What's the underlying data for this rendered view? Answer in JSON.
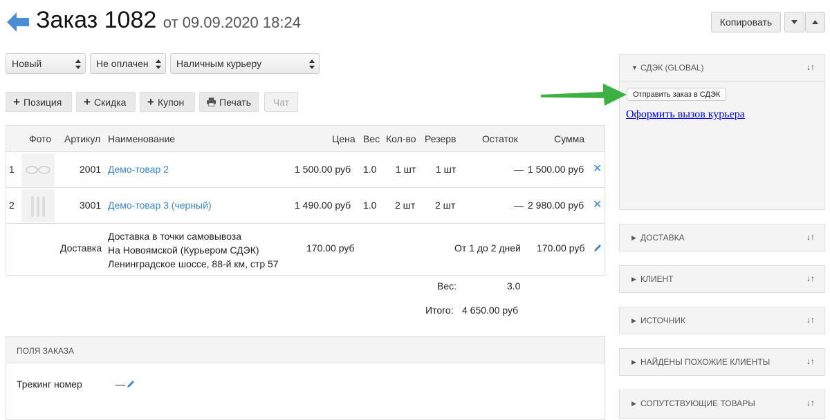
{
  "header": {
    "title": "Заказ 1082",
    "subtitle": "от 09.09.2020 18:24",
    "copy_label": "Копировать"
  },
  "selects": {
    "status": "Новый",
    "payment": "Не оплачен",
    "delivery": "Наличным курьеру"
  },
  "toolbar": {
    "position": "Позиция",
    "discount": "Скидка",
    "coupon": "Купон",
    "print": "Печать",
    "chat": "Чат"
  },
  "table": {
    "columns": [
      "Фото",
      "Артикул",
      "Наименование",
      "Цена",
      "Вес",
      "Кол-во",
      "Резерв",
      "Остаток",
      "Сумма"
    ],
    "rows": [
      {
        "num": "1",
        "sku": "2001",
        "name": "Демо-товар 2",
        "price": "1 500.00 руб",
        "weight": "1.0",
        "qty": "1 шт",
        "reserve": "1 шт",
        "stock": "—",
        "sum": "1 500.00 руб"
      },
      {
        "num": "2",
        "sku": "3001",
        "name": "Демо-товар 3 (черный)",
        "price": "1 490.00 руб",
        "weight": "1.0",
        "qty": "2 шт",
        "reserve": "2 шт",
        "stock": "—",
        "sum": "2 980.00 руб"
      }
    ],
    "shipping": {
      "label": "Доставка",
      "line1": "Доставка в точки самовывоза",
      "line2": "На Новоямской (Курьером СДЭК)",
      "line3": "Ленинградское шоссе, 88-й км, стр 57",
      "price": "170.00 руб",
      "term": "От 1 до 2 дней",
      "sum": "170.00 руб"
    }
  },
  "totals": {
    "weight_label": "Вес:",
    "weight": "3.0",
    "total_label": "Итого:",
    "total": "4 650.00 руб"
  },
  "order_fields": {
    "header": "ПОЛЯ ЗАКАЗА",
    "tracking_label": "Трекинг номер",
    "tracking_value": "—"
  },
  "panels": {
    "cdek_title": "СДЭК (GLOBAL)",
    "send_button": "Отправить заказ в СДЭК",
    "courier_link": "Оформить вызов курьера",
    "collapsed": [
      "ДОСТАВКА",
      "КЛИЕНТ",
      "ИСТОЧНИК",
      "НАЙДЕНЫ ПОХОЖИЕ КЛИЕНТЫ",
      "СОПУТСТВУЮЩИЕ ТОВАРЫ"
    ],
    "move_icons": "🠗🠕"
  },
  "colors": {
    "link": "#3a86c8",
    "arrow_green": "#3cb043",
    "back_arrow": "#4a8fd4"
  }
}
